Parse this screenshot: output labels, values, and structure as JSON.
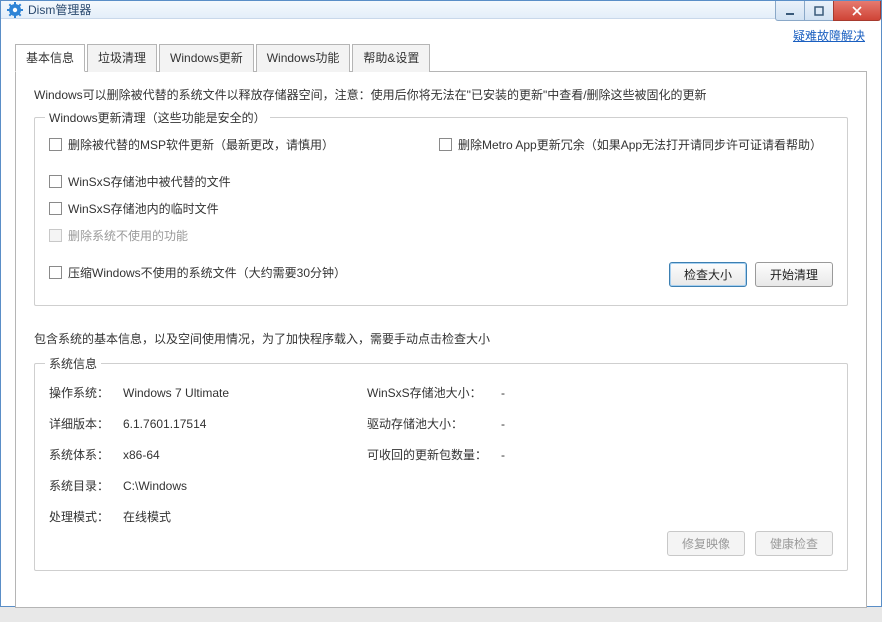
{
  "window": {
    "title": "Dism管理器"
  },
  "toplink": "疑难故障解决",
  "tabs": [
    {
      "label": "基本信息"
    },
    {
      "label": "垃圾清理"
    },
    {
      "label": "Windows更新"
    },
    {
      "label": "Windows功能"
    },
    {
      "label": "帮助&设置"
    }
  ],
  "intro": "Windows可以删除被代替的系统文件以释放存储器空间，注意：使用后你将无法在\"已安装的更新\"中查看/删除这些被固化的更新",
  "group1": {
    "title": "Windows更新清理（这些功能是安全的）",
    "chk_msp": "删除被代替的MSP软件更新（最新更改，请慎用）",
    "chk_metro": "删除Metro App更新冗余（如果App无法打开请同步许可证请看帮助）",
    "chk_winsxs_replaced": "WinSxS存储池中被代替的文件",
    "chk_winsxs_temp": "WinSxS存储池内的临时文件",
    "chk_unused_feature": "删除系统不使用的功能",
    "chk_compress": "压缩Windows不使用的系统文件（大约需要30分钟）",
    "btn_checksize": "检查大小",
    "btn_startclean": "开始清理"
  },
  "midtext": "包含系统的基本信息，以及空间使用情况，为了加快程序载入，需要手动点击检查大小",
  "group2": {
    "title": "系统信息",
    "labels": {
      "os": "操作系统：",
      "version": "详细版本：",
      "arch": "系统体系：",
      "sysdir": "系统目录：",
      "mode": "处理模式：",
      "winsxs_size": "WinSxS存储池大小：",
      "driver_size": "驱动存储池大小：",
      "reclaim_count": "可收回的更新包数量："
    },
    "values": {
      "os": "Windows 7 Ultimate",
      "version": "6.1.7601.17514",
      "arch": "x86-64",
      "sysdir": "C:\\Windows",
      "mode": "在线模式",
      "winsxs_size": "-",
      "driver_size": "-",
      "reclaim_count": "-"
    },
    "btn_repair": "修复映像",
    "btn_health": "健康检查"
  }
}
